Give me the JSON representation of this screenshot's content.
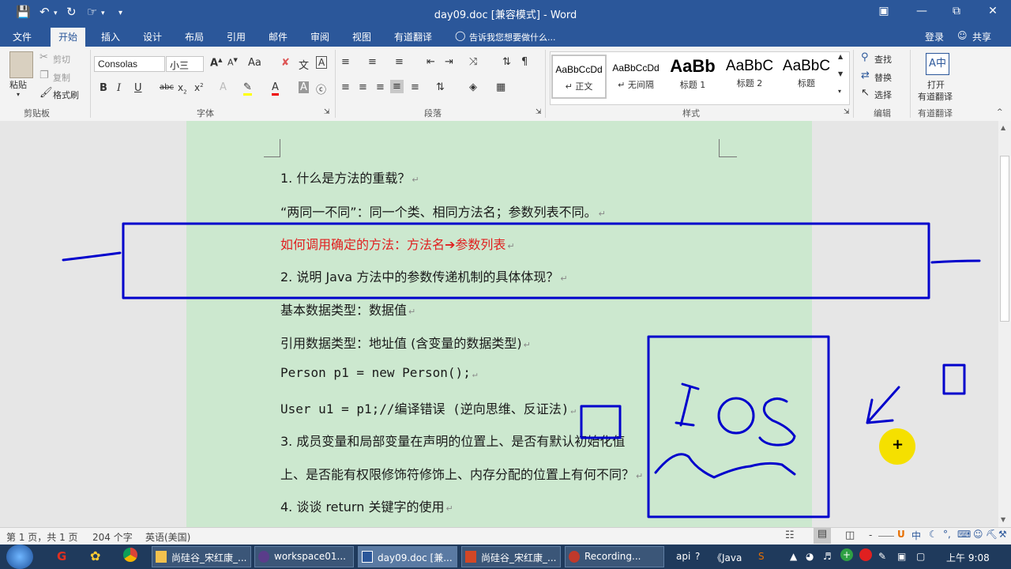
{
  "window": {
    "title": "day09.doc [兼容模式] - Word",
    "quick_access": [
      "save-icon",
      "undo-icon",
      "redo-icon",
      "touch-mode-icon",
      "customize-icon"
    ]
  },
  "tabs": [
    {
      "label": "文件"
    },
    {
      "label": "开始"
    },
    {
      "label": "插入"
    },
    {
      "label": "设计"
    },
    {
      "label": "布局"
    },
    {
      "label": "引用"
    },
    {
      "label": "邮件"
    },
    {
      "label": "审阅"
    },
    {
      "label": "视图"
    },
    {
      "label": "有道翻译"
    }
  ],
  "tellme": "告诉我您想要做什么...",
  "account": {
    "login": "登录",
    "share": "共享"
  },
  "ribbon": {
    "clipboard": {
      "paste": "粘贴",
      "cut": "剪切",
      "copy": "复制",
      "format_painter": "格式刷",
      "label": "剪贴板"
    },
    "font": {
      "name": "Consolas",
      "size": "小三",
      "label": "字体",
      "change_case": "Aa"
    },
    "paragraph": {
      "label": "段落"
    },
    "styles": {
      "label": "样式",
      "items": [
        {
          "preview": "AaBbCcDd",
          "name": "↵ 正文"
        },
        {
          "preview": "AaBbCcDd",
          "name": "↵ 无间隔"
        },
        {
          "preview": "AaBb",
          "name": "标题 1"
        },
        {
          "preview": "AaBbC",
          "name": "标题 2"
        },
        {
          "preview": "AaBbC",
          "name": "标题"
        }
      ]
    },
    "editing": {
      "find": "查找",
      "replace": "替换",
      "select": "选择",
      "label": "编辑"
    },
    "youdao": {
      "open_line1": "打开",
      "open_line2": "有道翻译",
      "label": "有道翻译"
    }
  },
  "document": {
    "lines": [
      {
        "text": "1. 什么是方法的重载？",
        "mono": false
      },
      {
        "text": "“两同一不同”：同一个类、相同方法名；参数列表不同。",
        "mono": false
      },
      {
        "text": "如何调用确定的方法：方法名➔参数列表",
        "mono": false,
        "red": true
      },
      {
        "text": "2. 说明 Java 方法中的参数传递机制的具体体现？",
        "mono": false
      },
      {
        "text": "基本数据类型：数据值",
        "mono": false
      },
      {
        "text": "引用数据类型：地址值 (含变量的数据类型)",
        "mono": false
      },
      {
        "text": "Person p1 =  new Person();",
        "mono": true
      },
      {
        "text": "User u1 = p1;//编译错误    (逆向思维、反证法)",
        "mono": true
      },
      {
        "text": "3. 成员变量和局部变量在声明的位置上、是否有默认初始化值",
        "mono": false
      },
      {
        "text": "上、是否能有权限修饰符修饰上、内存分配的位置上有何不同？",
        "mono": false
      },
      {
        "text": "4. 谈谈 return 关键字的使用",
        "mono": false
      }
    ],
    "annotation_text": "IOS"
  },
  "statusbar": {
    "page": "第 1 页，共 1 页",
    "words": "204 个字",
    "language": "英语(美国)"
  },
  "taskbar": {
    "items": [
      {
        "label": "尚硅谷_宋红康_..."
      },
      {
        "label": "workspace01..."
      },
      {
        "label": "day09.doc [兼..."
      },
      {
        "label": "尚硅谷_宋红康_..."
      },
      {
        "label": "Recording..."
      }
    ],
    "tray_text": "api",
    "tray_java": "《Java",
    "ime": "中",
    "time": "上午 9:08"
  },
  "colors": {
    "word_blue": "#2b579a",
    "page_bg": "#cce8cf",
    "annot_blue": "#0000cc",
    "red_text": "#e02020",
    "cursor_yellow": "#f5e000"
  }
}
